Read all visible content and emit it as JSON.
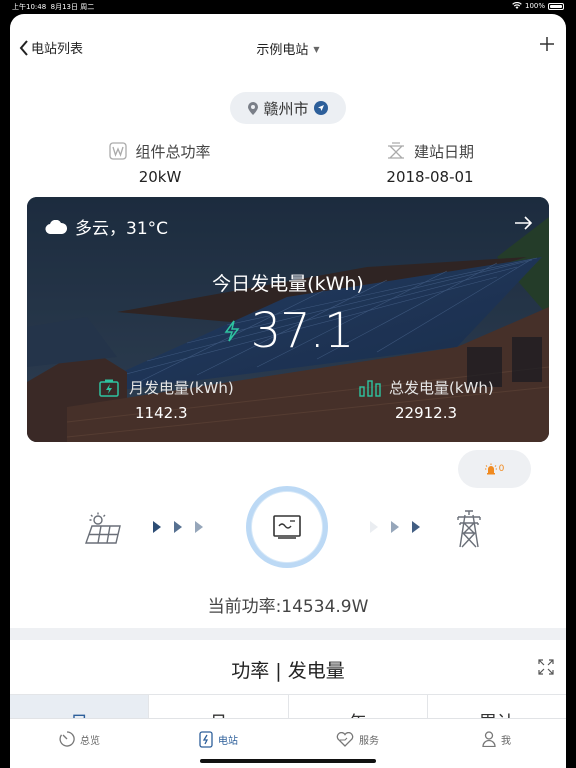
{
  "status_bar": {
    "time": "上午10:48",
    "date": "8月13日 周二",
    "battery": "100%"
  },
  "nav": {
    "back_label": "电站列表",
    "title": "示例电站"
  },
  "location": {
    "city": "赣州市"
  },
  "stats": {
    "capacity_label": "组件总功率",
    "capacity_value": "20kW",
    "build_date_label": "建站日期",
    "build_date_value": "2018-08-01"
  },
  "weather_card": {
    "weather": "多云，31°C",
    "today_label": "今日发电量(kWh)",
    "today_value": "37.1",
    "month_label": "月发电量(kWh)",
    "month_value": "1142.3",
    "total_label": "总发电量(kWh)",
    "total_value": "22912.3"
  },
  "alarm": {
    "count": "0"
  },
  "flow": {
    "power_text": "当前功率:14534.9W"
  },
  "chart_section": {
    "title": "功率 | 发电量"
  },
  "seg_tabs": [
    "日",
    "月",
    "年",
    "累计"
  ],
  "tabbar": {
    "items": [
      "总览",
      "电站",
      "服务",
      "我"
    ],
    "active_index": 1
  },
  "colors": {
    "accent": "#2d5f9a",
    "green": "#2ec4a0",
    "alarm": "#f08a20"
  }
}
